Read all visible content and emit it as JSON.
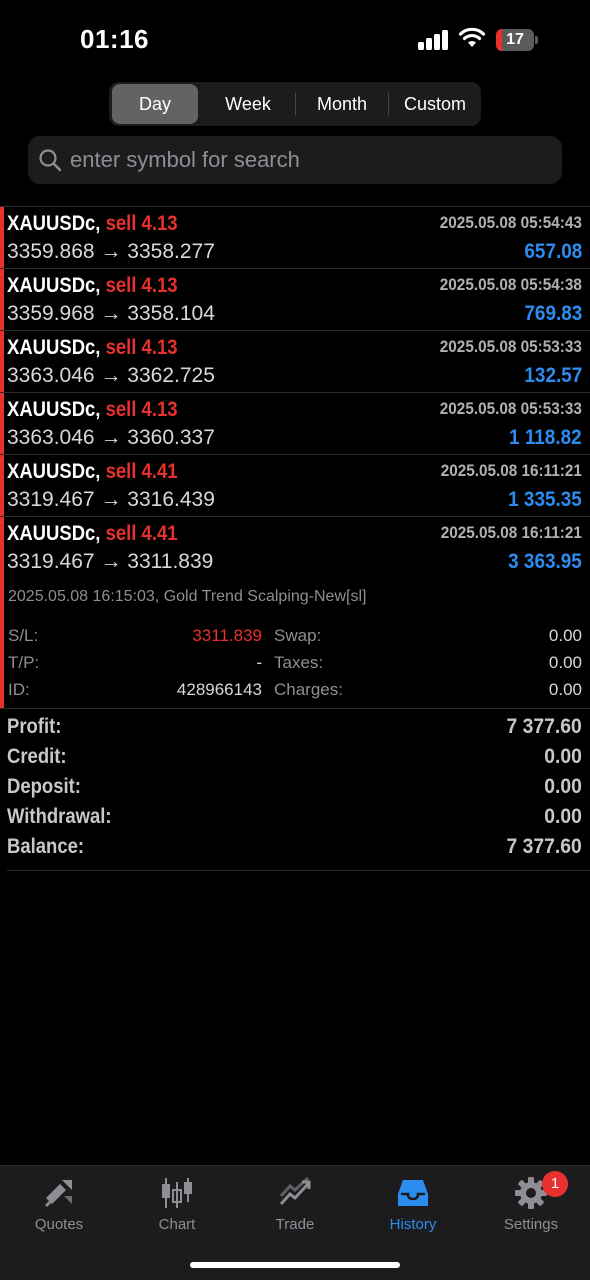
{
  "status_bar": {
    "time": "01:16",
    "battery": "17",
    "battery_level": 0.17
  },
  "period_tabs": [
    {
      "label": "Day",
      "active": true
    },
    {
      "label": "Week",
      "active": false
    },
    {
      "label": "Month",
      "active": false
    },
    {
      "label": "Custom",
      "active": false
    }
  ],
  "search": {
    "placeholder": "enter symbol for search"
  },
  "deals": [
    {
      "symbol": "XAUUSDc,",
      "type": "sell 4.13",
      "time": "2025.05.08 05:54:43",
      "open": "3359.868",
      "arrow": "→",
      "close": "3358.277",
      "profit": "657.08"
    },
    {
      "symbol": "XAUUSDc,",
      "type": "sell 4.13",
      "time": "2025.05.08 05:54:38",
      "open": "3359.968",
      "arrow": "→",
      "close": "3358.104",
      "profit": "769.83"
    },
    {
      "symbol": "XAUUSDc,",
      "type": "sell 4.13",
      "time": "2025.05.08 05:53:33",
      "open": "3363.046",
      "arrow": "→",
      "close": "3362.725",
      "profit": "132.57"
    },
    {
      "symbol": "XAUUSDc,",
      "type": "sell 4.13",
      "time": "2025.05.08 05:53:33",
      "open": "3363.046",
      "arrow": "→",
      "close": "3360.337",
      "profit": "1 118.82"
    },
    {
      "symbol": "XAUUSDc,",
      "type": "sell 4.41",
      "time": "2025.05.08 16:11:21",
      "open": "3319.467",
      "arrow": "→",
      "close": "3316.439",
      "profit": "1 335.35"
    },
    {
      "symbol": "XAUUSDc,",
      "type": "sell 4.41",
      "time": "2025.05.08 16:11:21",
      "open": "3319.467",
      "arrow": "→",
      "close": "3311.839",
      "profit": "3 363.95"
    }
  ],
  "expanded_deal": {
    "comment": "2025.05.08 16:15:03, Gold Trend Scalping-New[sl]",
    "sl_label": "S/L:",
    "sl_value": "3311.839",
    "tp_label": "T/P:",
    "tp_value": "-",
    "id_label": "ID:",
    "id_value": "428966143",
    "swap_label": "Swap:",
    "swap_value": "0.00",
    "taxes_label": "Taxes:",
    "taxes_value": "0.00",
    "charges_label": "Charges:",
    "charges_value": "0.00"
  },
  "summary": [
    {
      "label": "Profit:",
      "value": "7 377.60"
    },
    {
      "label": "Credit:",
      "value": "0.00"
    },
    {
      "label": "Deposit:",
      "value": "0.00"
    },
    {
      "label": "Withdrawal:",
      "value": "0.00"
    },
    {
      "label": "Balance:",
      "value": "7 377.60"
    }
  ],
  "tab_bar": [
    {
      "label": "Quotes",
      "icon": "quotes-icon",
      "active": false
    },
    {
      "label": "Chart",
      "icon": "chart-icon",
      "active": false
    },
    {
      "label": "Trade",
      "icon": "trade-icon",
      "active": false
    },
    {
      "label": "History",
      "icon": "history-icon",
      "active": true
    },
    {
      "label": "Settings",
      "icon": "gear-icon",
      "active": false,
      "badge": "1"
    }
  ],
  "colors": {
    "sell": "#e8312c",
    "profit": "#2d8cf0",
    "active_tab": "#2d8cf0",
    "inactive_tab": "#8e8e93"
  }
}
